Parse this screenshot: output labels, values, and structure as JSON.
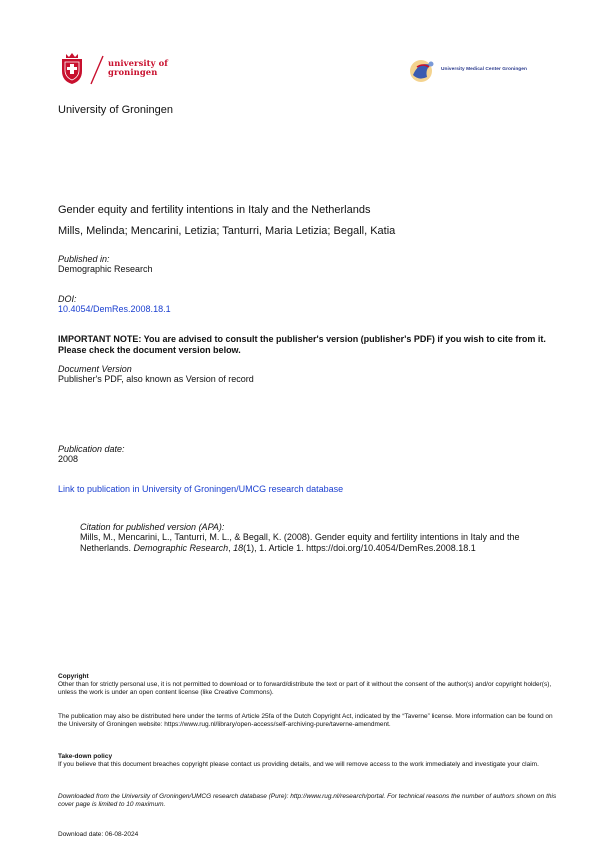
{
  "logos": {
    "rug_line1": "university of",
    "rug_line2": "groningen",
    "umcg_text": "University Medical Center Groningen"
  },
  "institution": "University of Groningen",
  "paper": {
    "title": "Gender equity and fertility intentions in Italy and the Netherlands",
    "authors": "Mills, Melinda; Mencarini, Letizia; Tanturri, Maria Letizia; Begall, Katia"
  },
  "published_in": {
    "label": "Published in:",
    "value": "Demographic Research"
  },
  "doi": {
    "label": "DOI:",
    "value": "10.4054/DemRes.2008.18.1"
  },
  "important_note": "IMPORTANT NOTE: You are advised to consult the publisher's version (publisher's PDF) if you wish to cite from it. Please check the document version below.",
  "document_version": {
    "label": "Document Version",
    "value": "Publisher's PDF, also known as Version of record"
  },
  "publication_date": {
    "label": "Publication date:",
    "value": "2008"
  },
  "database_link": "Link to publication in University of Groningen/UMCG research database",
  "citation": {
    "label": "Citation for published version (APA):",
    "part1": "Mills, M., Mencarini, L., Tanturri, M. L., & Begall, K. (2008). Gender equity and fertility intentions in Italy and the Netherlands. ",
    "journal": "Demographic Research",
    "part2": ", ",
    "volume": "18",
    "part3": "(1), 1. Article 1. https://doi.org/10.4054/DemRes.2008.18.1"
  },
  "copyright": {
    "heading": "Copyright",
    "body": "Other than for strictly personal use, it is not permitted to download or to forward/distribute the text or part of it without the consent of the author(s) and/or copyright holder(s), unless the work is under an open content license (like Creative Commons)."
  },
  "taverne": "The publication may also be distributed here under the terms of Article 25fa of the Dutch Copyright Act, indicated by the “Taverne” license. More information can be found on the University of Groningen website: https://www.rug.nl/library/open-access/self-archiving-pure/taverne-amendment.",
  "takedown": {
    "heading": "Take-down policy",
    "body": "If you believe that this document breaches copyright please contact us providing details, and we will remove access to the work immediately and investigate your claim."
  },
  "downloaded_from": "Downloaded from the University of Groningen/UMCG research database (Pure): http://www.rug.nl/research/portal. For technical reasons the number of authors shown on this cover page is limited to 10 maximum.",
  "download_date": "Download date: 06-08-2024"
}
